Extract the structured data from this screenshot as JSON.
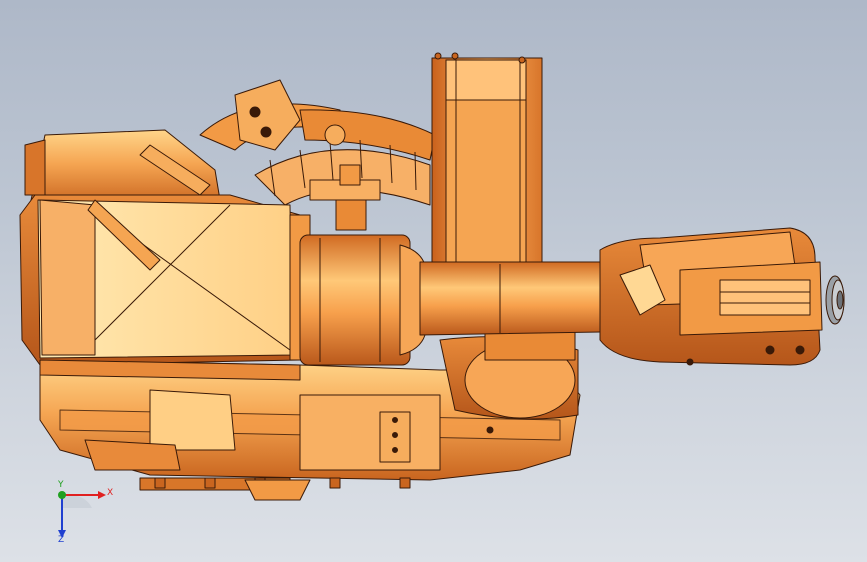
{
  "viewport": {
    "model": "robot-arm-cad-assembly",
    "colors": {
      "background_top": "#aeb8c8",
      "background_bottom": "#dde1e7",
      "body_light": "#ffe8a6",
      "body_mid": "#f2a24a",
      "body_dark": "#c8621c",
      "edge": "#3a1a08",
      "flange": "#8a8e94"
    }
  },
  "triad": {
    "x_label": "X",
    "y_label": "Y",
    "z_label": "Z",
    "x_color": "#e02020",
    "y_color": "#20a020",
    "z_color": "#2040d0"
  }
}
